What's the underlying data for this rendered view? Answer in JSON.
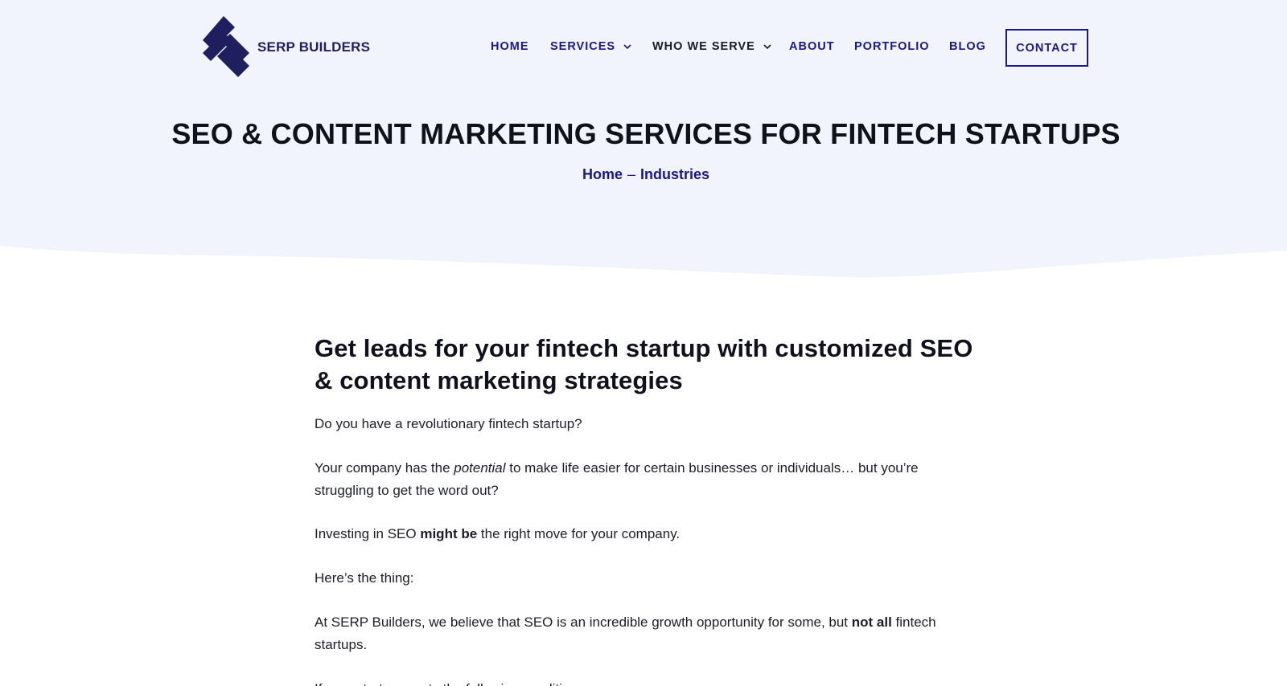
{
  "brand": {
    "name": "SERP BUILDERS",
    "primary_color": "#1b178c",
    "logo_color": "#1f1e5e",
    "hero_bg": "#f1f4fc"
  },
  "nav": {
    "items": [
      {
        "label": "HOME",
        "has_dropdown": false
      },
      {
        "label": "SERVICES",
        "has_dropdown": true
      },
      {
        "label": "WHO WE SERVE",
        "has_dropdown": true
      },
      {
        "label": "ABOUT",
        "has_dropdown": false
      },
      {
        "label": "PORTFOLIO",
        "has_dropdown": false
      },
      {
        "label": "BLOG",
        "has_dropdown": false
      }
    ],
    "contact_label": "CONTACT"
  },
  "hero": {
    "title": "SEO & CONTENT MARKETING SERVICES FOR FINTECH STARTUPS",
    "breadcrumb": {
      "home": "Home",
      "separator": "–",
      "current": "Industries"
    }
  },
  "content": {
    "heading": "Get leads for your fintech startup with customized SEO & content marketing strategies",
    "p1": "Do you have a revolutionary fintech startup?",
    "p2": {
      "before": "Your company has the ",
      "italic": "potential",
      "after": " to make life easier for certain businesses or individuals… but you’re struggling to get the word out?"
    },
    "p3": {
      "before": "Investing in SEO ",
      "bold": "might be",
      "after": " the right move for your company."
    },
    "p4": "Here’s the thing:",
    "p5": {
      "before": "At SERP Builders, we believe that SEO is an incredible growth opportunity for some, but ",
      "bold": "not all",
      "after": " fintech startups."
    },
    "p6": "If your startup meets the following conditions…"
  }
}
